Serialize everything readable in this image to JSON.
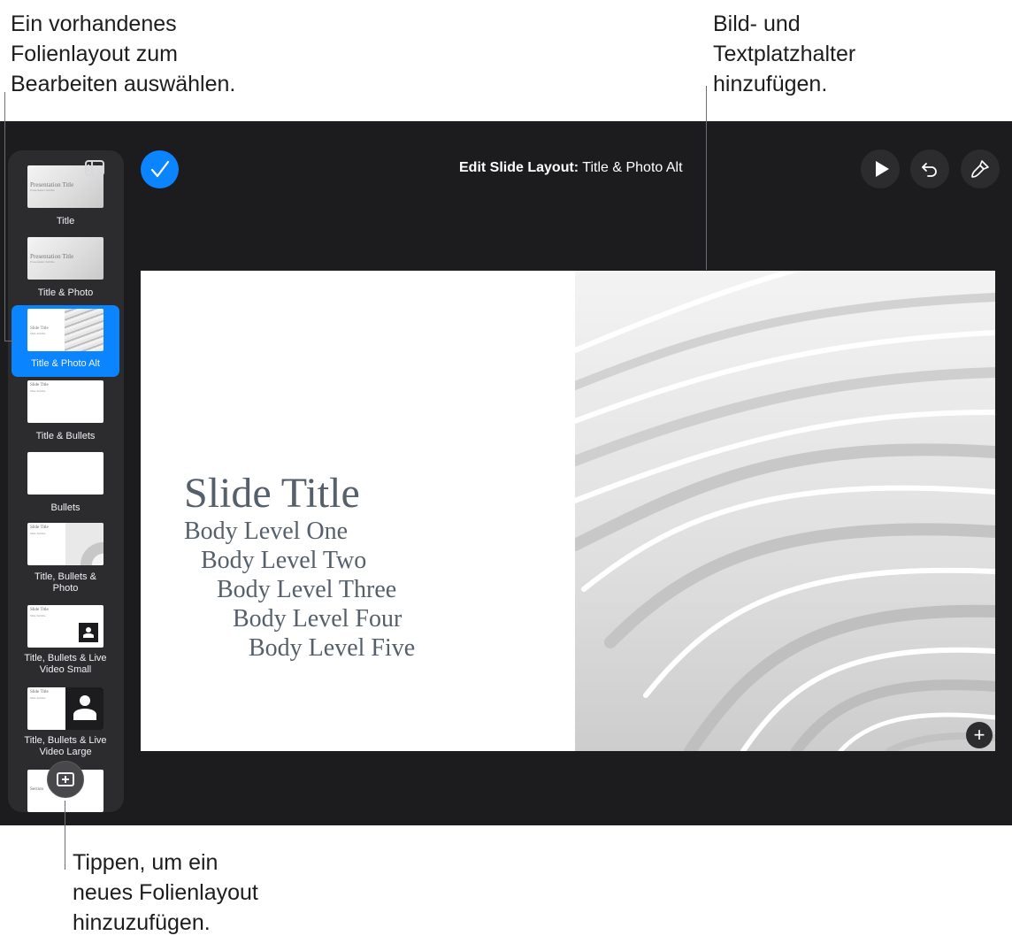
{
  "callouts": {
    "top_left": [
      "Ein vorhandenes",
      "Folienlayout zum",
      "Bearbeiten auswählen."
    ],
    "top_right": [
      "Bild- und",
      "Textplatzhalter",
      "hinzufügen."
    ],
    "bottom": [
      "Tippen, um ein",
      "neues Folienlayout",
      "hinzuzufügen."
    ]
  },
  "toolbar": {
    "title_prefix": "Edit Slide Layout:",
    "title_value": "Title & Photo Alt"
  },
  "layouts": [
    {
      "label": "Title",
      "thumb_title": "Presentation Title",
      "thumb_sub": "Presentation Subtitle"
    },
    {
      "label": "Title & Photo",
      "thumb_title": "Presentation Title",
      "thumb_sub": "Presentation Subtitle"
    },
    {
      "label": "Title & Photo Alt",
      "thumb_title": "Slide Title",
      "thumb_sub": "Slide Subtitle"
    },
    {
      "label": "Title & Bullets",
      "thumb_title": "Slide Title",
      "thumb_sub": "Slide Subtitle"
    },
    {
      "label": "Bullets"
    },
    {
      "label": "Title, Bullets & Photo",
      "thumb_title": "Slide Title",
      "thumb_sub": "Slide Subtitle"
    },
    {
      "label": "Title, Bullets & Live Video Small",
      "thumb_title": "Slide Title",
      "thumb_sub": "Slide Subtitle"
    },
    {
      "label": "Title, Bullets & Live Video Large",
      "thumb_title": "Slide Title",
      "thumb_sub": "Slide Subtitle"
    },
    {
      "thumb_title": "Section"
    }
  ],
  "slide": {
    "title": "Slide Title",
    "body": [
      "Body Level One",
      "Body Level Two",
      "Body Level Three",
      "Body Level Four",
      "Body Level Five"
    ]
  },
  "icons": {
    "sidebar_toggle": "sidebar-icon",
    "done": "checkmark-icon",
    "play": "play-icon",
    "undo": "undo-icon",
    "format": "paintbrush-icon",
    "add_object": "plus-icon",
    "add_layout": "add-slide-icon"
  },
  "colors": {
    "accent": "#0a84ff",
    "app_background": "#1c1c1e",
    "sidebar_background": "#2c2c2e",
    "slide_text": "#56606b"
  }
}
